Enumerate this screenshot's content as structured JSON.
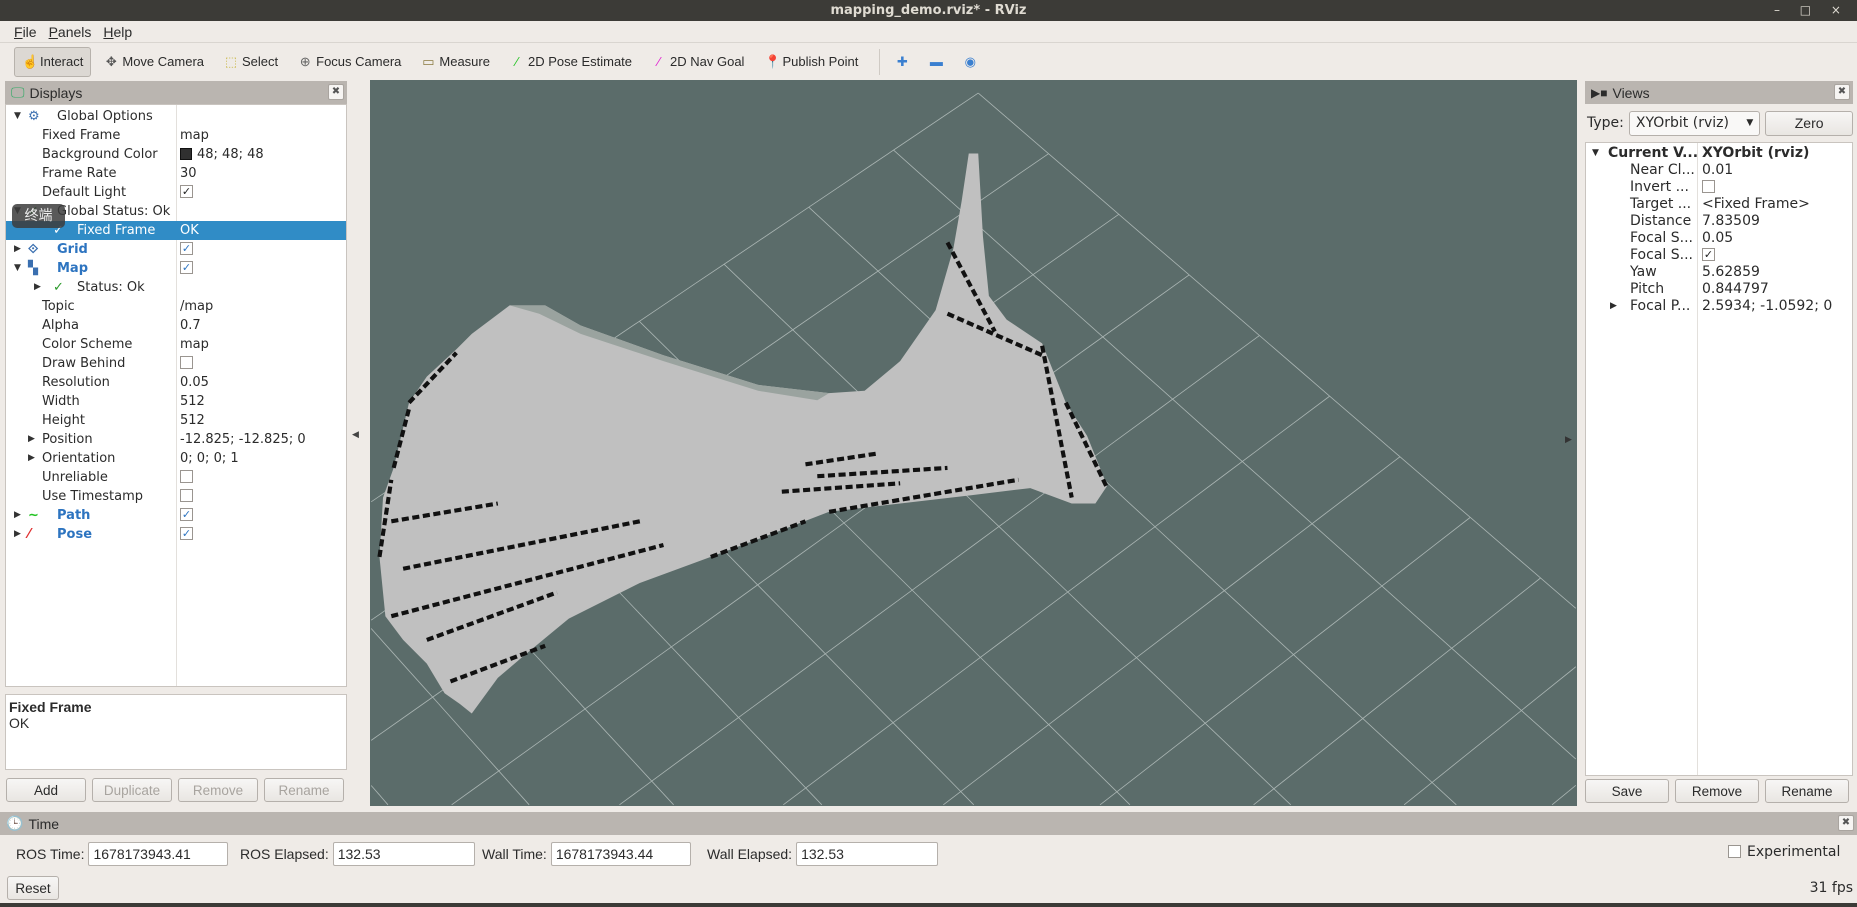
{
  "window": {
    "title": "mapping_demo.rviz* - RViz",
    "controls": "– □ ×"
  },
  "menu": [
    "File",
    "Panels",
    "Help"
  ],
  "toolbar": {
    "tools": [
      {
        "label": "Interact",
        "icon": "hand-pointer-icon",
        "glyph": "☝",
        "color": "#333",
        "active": true
      },
      {
        "label": "Move Camera",
        "icon": "move-camera-icon",
        "glyph": "✥",
        "color": "#555"
      },
      {
        "label": "Select",
        "icon": "select-icon",
        "glyph": "⬚",
        "color": "#c9b84a"
      },
      {
        "label": "Focus Camera",
        "icon": "focus-camera-icon",
        "glyph": "⊕",
        "color": "#666"
      },
      {
        "label": "Measure",
        "icon": "ruler-icon",
        "glyph": "▭",
        "color": "#8a7a40"
      },
      {
        "label": "2D Pose Estimate",
        "icon": "pose-estimate-arrow-icon",
        "glyph": "⁄",
        "color": "#22c322"
      },
      {
        "label": "2D Nav Goal",
        "icon": "nav-goal-arrow-icon",
        "glyph": "⁄",
        "color": "#e020d0"
      },
      {
        "label": "Publish Point",
        "icon": "map-pin-icon",
        "glyph": "📍",
        "color": "#c0402a"
      }
    ],
    "extra": [
      {
        "icon": "plus-icon",
        "glyph": "✚"
      },
      {
        "icon": "minus-icon",
        "glyph": "▬"
      },
      {
        "icon": "eye-icon",
        "glyph": "◉"
      }
    ]
  },
  "displays": {
    "title": "Displays",
    "rows": [
      {
        "level": 0,
        "arrow": "down",
        "icon": "gear-icon",
        "glyph": "⚙",
        "label": "Global Options",
        "value": ""
      },
      {
        "level": 1,
        "label": "Fixed Frame",
        "value": "map"
      },
      {
        "level": 1,
        "label": "Background Color",
        "value": "48; 48; 48",
        "swatch": true
      },
      {
        "level": 1,
        "label": "Frame Rate",
        "value": "30"
      },
      {
        "level": 1,
        "label": "Default Light",
        "check": true
      },
      {
        "level": 0,
        "arrow": "down",
        "icon": "check-icon",
        "glyph": "✓",
        "label": "Global Status: Ok",
        "value": ""
      },
      {
        "level": 2,
        "icon": "check-icon",
        "glyph": "✓",
        "label": "Fixed Frame",
        "value": "OK",
        "selected": true
      },
      {
        "level": 0,
        "arrow": "right",
        "icon": "grid-icon",
        "glyph": "⟐",
        "label": "Grid",
        "bold": true,
        "check": true
      },
      {
        "level": 0,
        "arrow": "down",
        "icon": "map-icon",
        "glyph": "▚",
        "label": "Map",
        "bold": true,
        "check": true
      },
      {
        "level": 2,
        "arrow": "right",
        "icon": "check-icon",
        "glyph": "✓",
        "label": "Status: Ok",
        "value": ""
      },
      {
        "level": 1,
        "label": "Topic",
        "value": "/map"
      },
      {
        "level": 1,
        "label": "Alpha",
        "value": "0.7"
      },
      {
        "level": 1,
        "label": "Color Scheme",
        "value": "map"
      },
      {
        "level": 1,
        "label": "Draw Behind",
        "check": false
      },
      {
        "level": 1,
        "label": "Resolution",
        "value": "0.05"
      },
      {
        "level": 1,
        "label": "Width",
        "value": "512"
      },
      {
        "level": 1,
        "label": "Height",
        "value": "512"
      },
      {
        "level": 1,
        "arrow": "right",
        "label": "Position",
        "value": "-12.825; -12.825; 0"
      },
      {
        "level": 1,
        "arrow": "right",
        "label": "Orientation",
        "value": "0; 0; 0; 1"
      },
      {
        "level": 1,
        "label": "Unreliable",
        "check": false
      },
      {
        "level": 1,
        "label": "Use Timestamp",
        "check": false
      },
      {
        "level": 0,
        "arrow": "right",
        "icon": "path-icon",
        "glyph": "∼",
        "iconColor": "#22c322",
        "label": "Path",
        "bold": true,
        "check": true
      },
      {
        "level": 0,
        "arrow": "right",
        "icon": "pose-arrow-icon",
        "glyph": "⁄",
        "iconColor": "#e03030",
        "label": "Pose",
        "bold": true,
        "check": true
      }
    ],
    "description": {
      "title": "Fixed Frame",
      "text": "OK"
    },
    "buttons": [
      {
        "label": "Add",
        "enabled": true
      },
      {
        "label": "Duplicate",
        "enabled": false
      },
      {
        "label": "Remove",
        "enabled": false
      },
      {
        "label": "Rename",
        "enabled": false
      }
    ],
    "tooltip": "终端"
  },
  "views": {
    "title": "Views",
    "type_label": "Type:",
    "type_value": "XYOrbit (rviz)",
    "zero_label": "Zero",
    "rows": [
      {
        "label": "Current V...",
        "value": "XYOrbit (rviz)",
        "bold": true,
        "arrow": "down"
      },
      {
        "label": "Near Cl...",
        "value": "0.01"
      },
      {
        "label": "Invert ...",
        "check": false
      },
      {
        "label": "Target ...",
        "value": "<Fixed Frame>"
      },
      {
        "label": "Distance",
        "value": "7.83509"
      },
      {
        "label": "Focal S...",
        "value": "0.05"
      },
      {
        "label": "Focal S...",
        "check": true
      },
      {
        "label": "Yaw",
        "value": "5.62859"
      },
      {
        "label": "Pitch",
        "value": "0.844797"
      },
      {
        "label": "Focal P...",
        "value": "2.5934; -1.0592; 0",
        "arrow": "right"
      }
    ],
    "buttons": [
      "Save",
      "Remove",
      "Rename"
    ]
  },
  "time": {
    "title": "Time",
    "fields": [
      {
        "label": "ROS Time:",
        "value": "1678173943.41"
      },
      {
        "label": "ROS Elapsed:",
        "value": "132.53"
      },
      {
        "label": "Wall Time:",
        "value": "1678173943.44"
      },
      {
        "label": "Wall Elapsed:",
        "value": "132.53"
      }
    ],
    "reset_label": "Reset",
    "experimental_label": "Experimental",
    "experimental_checked": false,
    "fps": "31 fps"
  },
  "colors": {
    "viewport_bg": "#5b6c6a",
    "map_free": "#c0c0c0",
    "map_occupied": "#111111",
    "selection": "#308cc6",
    "display_name": "#2d74c0"
  }
}
